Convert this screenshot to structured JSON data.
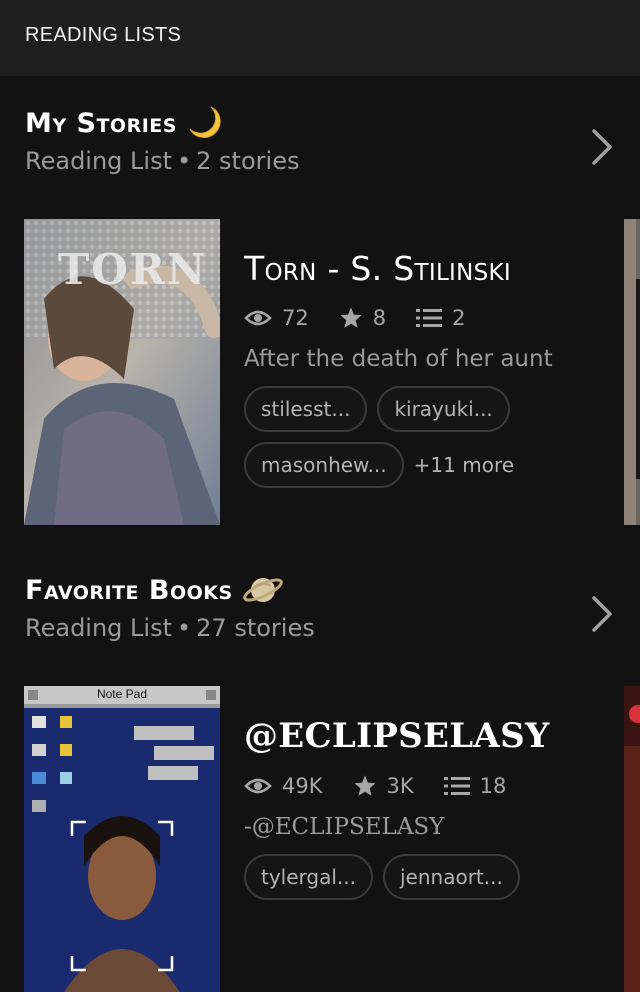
{
  "header": {
    "title": "READING LISTS"
  },
  "lists": [
    {
      "title": "My Stories",
      "emoji": "crescent-moon-icon",
      "subtitle_prefix": "Reading List",
      "subtitle_count": "2 stories",
      "book": {
        "cover_text": "TORN",
        "title": "Torn - S. Stilinski",
        "views": "72",
        "votes": "8",
        "parts": "2",
        "description": "After the death of her aunt",
        "tags": [
          "stilesst...",
          "kirayuki...",
          "masonhew..."
        ],
        "more": "+11 more"
      }
    },
    {
      "title": "Favorite Books",
      "emoji": "saturn-icon",
      "subtitle_prefix": "Reading List",
      "subtitle_count": "27 stories",
      "book": {
        "cover_window_title": "Note Pad",
        "title": "@ECLIPSELASY",
        "views": "49K",
        "votes": "3K",
        "parts": "18",
        "description": "-@ECLIPSELASY",
        "tags": [
          "tylergal...",
          "jennaort..."
        ]
      }
    }
  ],
  "colors": {
    "background": "#121212",
    "topbar": "#1f1f1f",
    "muted_text": "#9a9a9a",
    "chip_border": "#3a3a3a"
  }
}
